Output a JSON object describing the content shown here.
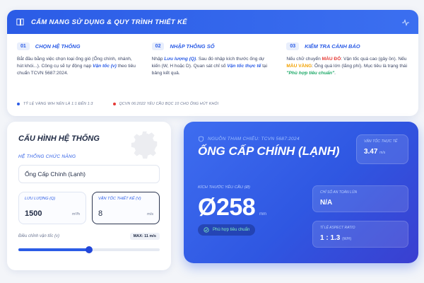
{
  "guide": {
    "title": "CẨM NANG SỬ DỤNG & QUY TRÌNH THIẾT KẾ",
    "steps": [
      {
        "num": "01",
        "title": "CHỌN HỆ THỐNG",
        "text_a": "Bắt đầu bằng việc chọn loại ống gió (Ống chính, nhánh, hút khói...). Công cụ sẽ tự động nạp ",
        "hl": "Vận tốc (v)",
        "text_b": " theo tiêu chuẩn TCVN 5687:2024."
      },
      {
        "num": "02",
        "title": "NHẬP THÔNG SỐ",
        "text_a": "Nhập ",
        "hl": "Lưu lượng (Q)",
        "text_b": ". Sau đó nhập kích thước ống dự kiến (W, H hoặc D). Quan sát chỉ số ",
        "hl2": "Vận tốc thực tế",
        "text_c": " tại bảng kết quả."
      },
      {
        "num": "03",
        "title": "KIỂM TRA CẢNH BÁO",
        "text_a": "Nếu chữ chuyển ",
        "red": "MÀU ĐỎ",
        "text_b": ": Vận tốc quá cao (gây ồn). Nếu ",
        "orange": "MÀU VÀNG",
        "text_c": ": Ống quá lớn (lãng phí). Mục tiêu là trạng thái ",
        "green": "\"Phù hợp tiêu chuẩn\"",
        "text_d": "."
      }
    ],
    "footer": [
      {
        "text": "TỶ LỆ VÀNG W/H NÊN LÀ 1:1 ĐẾN 1:3",
        "color": "#2b5ce6"
      },
      {
        "text": "QCVN 06:2022 YÊU CẦU BỌC 10 CHO ỐNG HÚT KHÓI",
        "color": "#e53935"
      }
    ]
  },
  "config": {
    "title": "CẤU HÌNH HỆ THỐNG",
    "function_label": "HỆ THỐNG CHỨC NĂNG",
    "system_value": "Ống Cấp Chính (Lạnh)",
    "flow": {
      "label": "LƯU LƯỢNG (Q)",
      "value": "1500",
      "unit": "m³/h"
    },
    "velocity": {
      "label": "VẬN TỐC THIẾT KẾ (V)",
      "value": "8",
      "unit": "m/s"
    },
    "slider": {
      "label": "Điều chỉnh vận tốc (v)",
      "max": "MAX: 11 m/s",
      "fraction": 0.5
    }
  },
  "result": {
    "source": "NGUỒN THAM CHIẾU: TCVN 5687:2024",
    "title": "ỐNG CẤP CHÍNH (LẠNH)",
    "actual_velocity": {
      "label": "VẬN TỐC THỰC TẾ",
      "value": "3.47",
      "unit": "m/s"
    },
    "size_label": "KÍCH THƯỚC YÊU CẦU (Ø)",
    "size_value": "Ø258",
    "size_unit": "mm",
    "status": "Phù hợp tiêu chuẩn",
    "fire": {
      "label": "CHỈ SỐ AN TOÀN LỬA",
      "value": "N/A"
    },
    "aspect": {
      "label": "TỈ LỆ ASPECT RATIO",
      "value": "1 : 1.3",
      "unit": "(W/H)"
    }
  }
}
